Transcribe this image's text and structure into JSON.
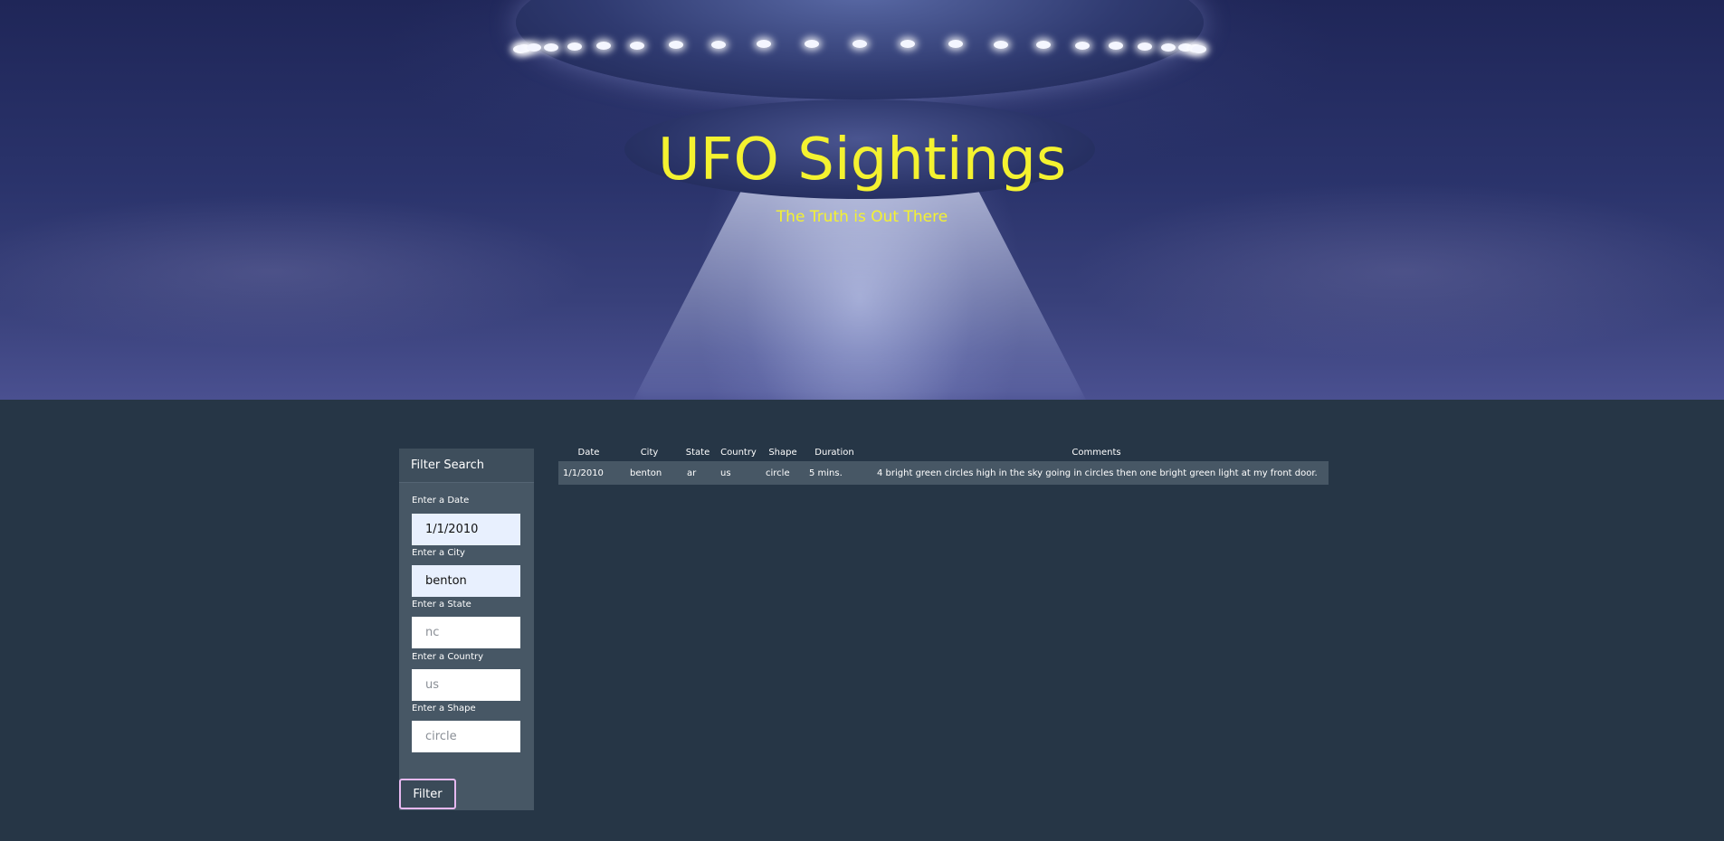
{
  "header": {
    "title": "UFO Sightings",
    "subtitle": "The Truth is Out There"
  },
  "filter": {
    "heading": "Filter Search",
    "fields": [
      {
        "label": "Enter a Date",
        "value": "1/1/2010",
        "placeholder": ""
      },
      {
        "label": "Enter a City",
        "value": "benton",
        "placeholder": ""
      },
      {
        "label": "Enter a State",
        "value": "",
        "placeholder": "nc"
      },
      {
        "label": "Enter a Country",
        "value": "",
        "placeholder": "us"
      },
      {
        "label": "Enter a Shape",
        "value": "",
        "placeholder": "circle"
      }
    ],
    "button_label": "Filter"
  },
  "table": {
    "columns": [
      "Date",
      "City",
      "State",
      "Country",
      "Shape",
      "Duration",
      "Comments"
    ],
    "rows": [
      [
        "1/1/2010",
        "benton",
        "ar",
        "us",
        "circle",
        "5 mins.",
        "4 bright green circles high in the sky going in circles then one bright green light at my front door."
      ]
    ]
  },
  "colors": {
    "title": "#f4f230",
    "page_background": "#263646",
    "panel_background": "#475765",
    "button_border": "#e6b8f0"
  }
}
